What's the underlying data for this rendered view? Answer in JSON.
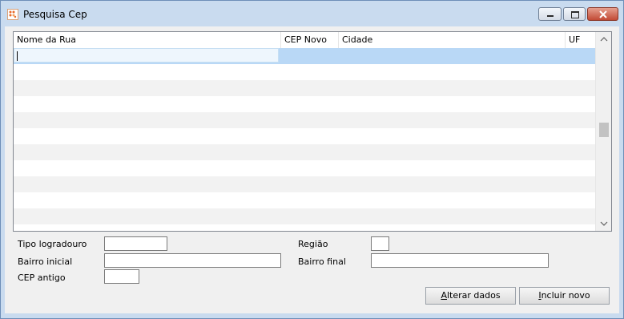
{
  "window": {
    "title": "Pesquisa Cep",
    "icon": "app-logo-icon",
    "controls": [
      "minimize-icon",
      "maximize-icon",
      "close-icon"
    ]
  },
  "grid": {
    "columns": [
      "Nome da Rua",
      "CEP Novo",
      "Cidade",
      "UF"
    ],
    "selected_row": 0,
    "row_count_visible": 12
  },
  "form": {
    "tipo_logradouro": {
      "label": "Tipo logradouro",
      "value": ""
    },
    "regiao": {
      "label": "Região",
      "value": ""
    },
    "bairro_inicial": {
      "label": "Bairro inicial",
      "value": ""
    },
    "bairro_final": {
      "label": "Bairro final",
      "value": ""
    },
    "cep_antigo": {
      "label": "CEP antigo",
      "value": ""
    }
  },
  "buttons": {
    "alterar": {
      "label_mnemonic": "A",
      "label_rest": "lterar dados"
    },
    "incluir": {
      "label_mnemonic": "I",
      "label_rest": "ncluir novo"
    }
  },
  "colors": {
    "selection": "#b9d8f6",
    "stripe": "#f2f2f2",
    "frame": "#c9dbef"
  }
}
